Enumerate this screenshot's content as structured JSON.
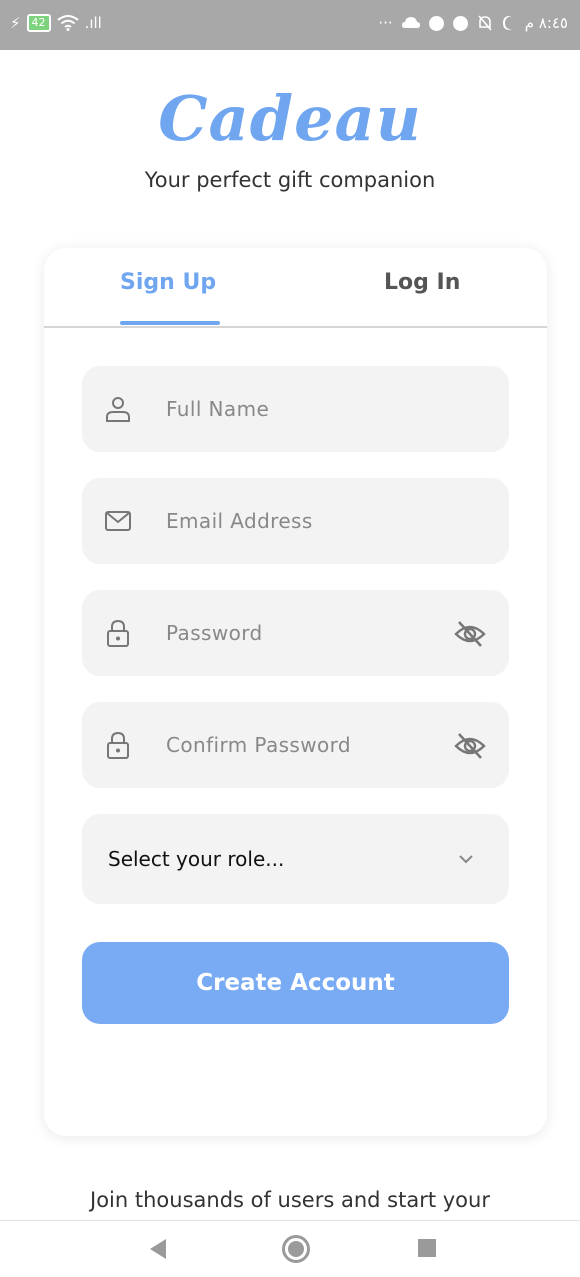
{
  "status_bar": {
    "battery": "42",
    "signal": ".ıll",
    "more": "···",
    "time": "٨:٤٥ م"
  },
  "brand": {
    "logo": "Cadeau",
    "tagline": "Your perfect gift companion"
  },
  "tabs": {
    "signup": "Sign Up",
    "login": "Log In"
  },
  "form": {
    "full_name_placeholder": "Full Name",
    "email_placeholder": "Email Address",
    "password_placeholder": "Password",
    "confirm_password_placeholder": "Confirm Password",
    "role_placeholder": "Select your role...",
    "submit_label": "Create Account"
  },
  "footer": {
    "text": "Join thousands of users and start your"
  },
  "colors": {
    "accent": "#6fa6ef",
    "button": "#79aaf4",
    "field_bg": "#f3f3f3"
  }
}
